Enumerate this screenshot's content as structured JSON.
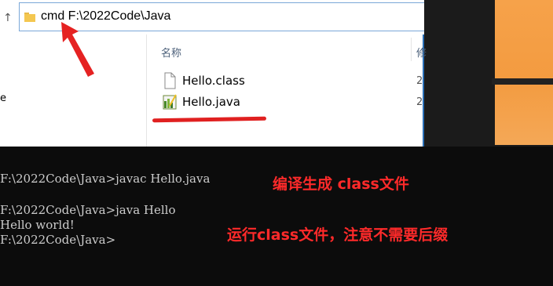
{
  "explorer": {
    "address_value": "cmd F:\\2022Code\\Java",
    "nav_label": "e",
    "column_name": "名称",
    "column_modified_partial": "修",
    "files": [
      {
        "name": "Hello.class",
        "icon": "file-icon",
        "date_partial": "2"
      },
      {
        "name": "Hello.java",
        "icon": "java-file-icon",
        "date_partial": "2"
      }
    ]
  },
  "terminal": {
    "lines": [
      "F:\\2022Code\\Java>javac Hello.java",
      "F:\\2022Code\\Java>java Hello",
      "Hello world!",
      "F:\\2022Code\\Java>"
    ]
  },
  "annotations": {
    "compile_note": "编译生成 class文件",
    "run_note": "运行class文件，注意不需要后缀"
  },
  "colors": {
    "annotation_red": "#ff2a2a",
    "address_border": "#7aa7d8",
    "desktop_orange": "#f6a24a"
  }
}
